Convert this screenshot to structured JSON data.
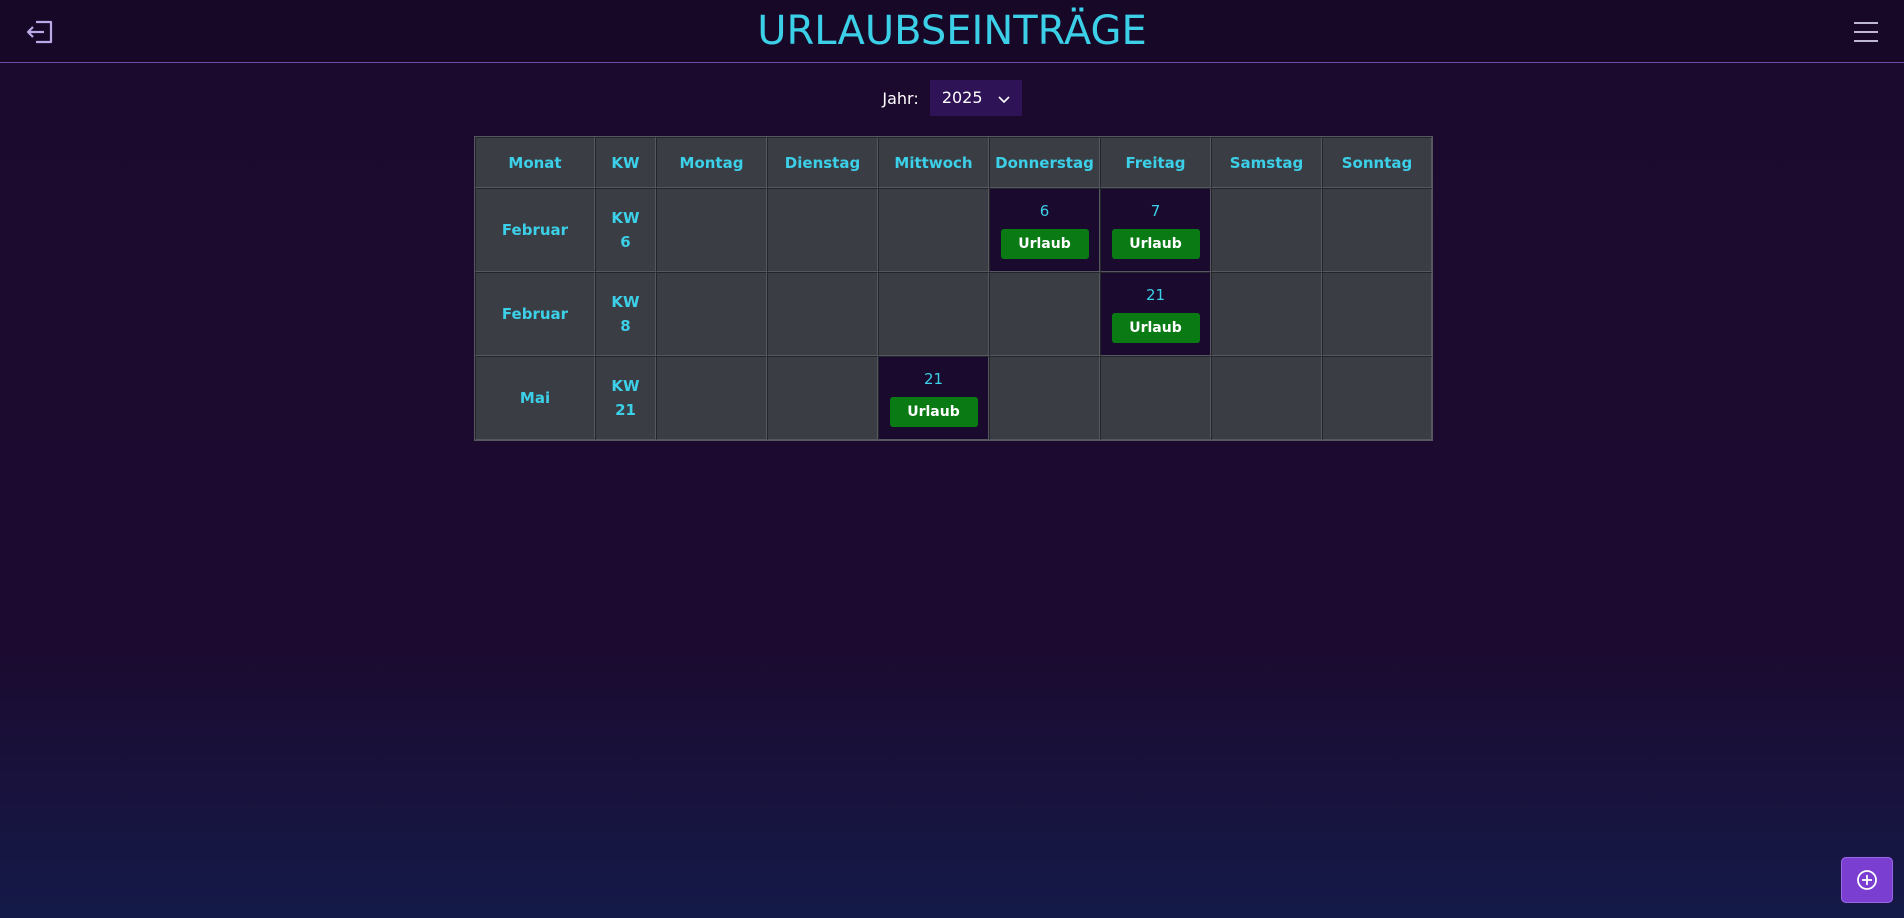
{
  "header": {
    "title": "URLAUBSEINTRÄGE",
    "logout_icon": "logout-icon",
    "menu_icon": "hamburger-menu-icon"
  },
  "year_filter": {
    "label": "Jahr:",
    "selected": "2025"
  },
  "calendar": {
    "headers": [
      "Monat",
      "KW",
      "Montag",
      "Dienstag",
      "Mittwoch",
      "Donnerstag",
      "Freitag",
      "Samstag",
      "Sonntag"
    ],
    "rows": [
      {
        "month": "Februar",
        "kw_label": "KW",
        "kw_number": "6",
        "days": [
          null,
          null,
          null,
          {
            "day": "6",
            "entry": "Urlaub"
          },
          {
            "day": "7",
            "entry": "Urlaub"
          },
          null,
          null
        ]
      },
      {
        "month": "Februar",
        "kw_label": "KW",
        "kw_number": "8",
        "days": [
          null,
          null,
          null,
          null,
          {
            "day": "21",
            "entry": "Urlaub"
          },
          null,
          null
        ]
      },
      {
        "month": "Mai",
        "kw_label": "KW",
        "kw_number": "21",
        "days": [
          null,
          null,
          {
            "day": "21",
            "entry": "Urlaub"
          },
          null,
          null,
          null,
          null
        ]
      }
    ]
  },
  "fab": {
    "icon": "plus-circle-icon"
  },
  "colors": {
    "accent_cyan": "#3ccfe8",
    "entry_green": "#0a7a14",
    "fab_purple": "#7a3fd0"
  }
}
